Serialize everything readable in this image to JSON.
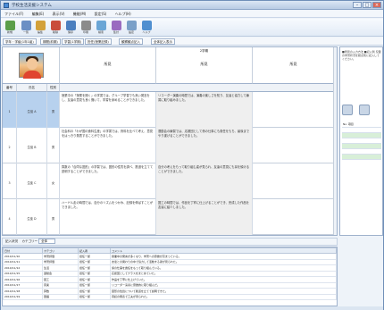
{
  "window": {
    "title": "学校生活支援システム"
  },
  "menu": [
    "ファイル(F)",
    "編集(E)",
    "表示(V)",
    "機能(M)",
    "設定(S)",
    "ヘルプ(H)"
  ],
  "toolbar": {
    "buttons": [
      {
        "label": "新規",
        "icon": "person-add-icon",
        "color": "#5a9e4a"
      },
      {
        "label": "一覧",
        "icon": "list-icon",
        "color": "#6b8fc4"
      },
      {
        "label": "編集",
        "icon": "edit-icon",
        "color": "#d3a13a"
      },
      {
        "label": "削除",
        "icon": "delete-icon",
        "color": "#c94c3c"
      },
      {
        "label": "保存",
        "icon": "save-icon",
        "color": "#4a7fbf"
      },
      {
        "label": "印刷",
        "icon": "print-icon",
        "color": "#8b8b8b"
      },
      {
        "label": "検索",
        "icon": "search-icon",
        "color": "#6aa6d6"
      },
      {
        "label": "集計",
        "icon": "chart-icon",
        "color": "#9a6bc0"
      },
      {
        "label": "設定",
        "icon": "gear-icon",
        "color": "#7aa0c8"
      },
      {
        "label": "ヘルプ",
        "icon": "help-icon",
        "color": "#4f8fd0"
      }
    ]
  },
  "filterbar": {
    "chips": [
      "学年・学級(1年1組)",
      "期間(前期)",
      "学習(1学期)",
      "担任(授業記録)",
      "観察観点記入",
      "全体記入表示"
    ]
  },
  "grid": {
    "header_left": "写真",
    "subheaders": [
      "番号",
      "氏名",
      "性別"
    ],
    "col_headers": [
      "所見",
      "所見",
      "所見"
    ],
    "col_headers_top": [
      "",
      "2学期",
      ""
    ],
    "rows": [
      {
        "num": "1",
        "name": "生徒 A",
        "sex": "男",
        "notes": [
          "授業中の「授業を聞く」の学習では、グループ学習でも良い発言をし、友達の意見も良く聞いて、学習を深めることができました。",
          "リコーダー演奏の時間では、演奏の楽しさを知り、友達と協力して練習に取り組みました。",
          ""
        ]
      },
      {
        "num": "2",
        "name": "生徒 B",
        "sex": "男",
        "notes": [
          "社会科の「わが国の食料生産」の学習では、資料を比べて考え、意見をはっきり発表することができました。",
          "運動会の練習では、応援団として係の仕事にも責任をもち、最後までやり遂げることができました。",
          ""
        ]
      },
      {
        "num": "3",
        "name": "生徒 C",
        "sex": "女",
        "notes": [
          "算数の「合同な図形」の学習では、図形の性質を調べ、筋道を立てて説明することができました。",
          "自分の考えをもって取り組む姿が見られ、友達の意見にも耳を傾けることができました。",
          ""
        ]
      },
      {
        "num": "4",
        "name": "生徒 D",
        "sex": "男",
        "notes": [
          "ハードル走の時間では、自分のリズムをつかみ、記録を伸ばすことができました。",
          "図工の時間では、作品を丁寧に仕上げることができ、完成した作品を友達に紹介しました。",
          ""
        ]
      }
    ]
  },
  "rightpane": {
    "text": "■所見の入力方法 ■記入例 児童の学習状況を観点別に記入してください。",
    "list": [
      "No. 項目",
      "",
      "",
      "",
      "",
      "",
      ""
    ]
  },
  "lowerbar": {
    "label": "記入状況",
    "filter_label": "カテゴリー",
    "filter_value": "全体"
  },
  "log": {
    "headers": [
      "日付",
      "カテゴリ",
      "記入者",
      "コメント"
    ],
    "rows": [
      [
        "2010/11/10",
        "学習評価",
        "担任一郎",
        "授業中の発言が多くなり、学習への意欲が高まっている。"
      ],
      [
        "2010/11/11",
        "学習評価",
        "担任一郎",
        "友達との関わりの中で協力して活動する姿が見られた。"
      ],
      [
        "2010/11/12",
        "生活",
        "担任一郎",
        "係の仕事を責任をもって取り組んでいる。"
      ],
      [
        "2010/11/15",
        "運動会",
        "担任一郎",
        "応援団としてクラスをまとめていた。"
      ],
      [
        "2010/11/16",
        "図工",
        "担任一郎",
        "作品を丁寧に仕上げていた。"
      ],
      [
        "2010/11/17",
        "音楽",
        "担任一郎",
        "リコーダー演奏に意欲的に取り組んだ。"
      ],
      [
        "2010/11/18",
        "算数",
        "担任一郎",
        "図形の性質について筋道を立てて説明できた。"
      ],
      [
        "2010/11/19",
        "国語",
        "担任一郎",
        "音読の発表で工夫が見られた。"
      ]
    ]
  }
}
